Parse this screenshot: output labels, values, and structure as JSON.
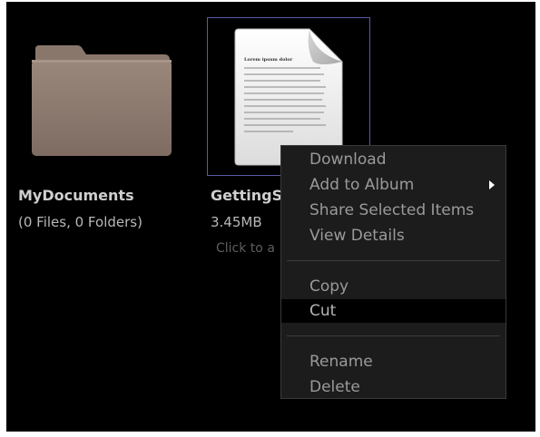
{
  "folder": {
    "name": "MyDocuments",
    "meta": "(0 Files, 0 Folders)",
    "icon": "folder-icon",
    "color": "#8c7a70"
  },
  "file": {
    "name": "GettingS",
    "size": "3.45MB",
    "hint": "Click to a",
    "icon": "document-icon",
    "doc_heading": "Lorem ipsum dolor"
  },
  "context_menu": {
    "items": [
      {
        "label": "Download"
      },
      {
        "label": "Add to Album",
        "submenu": true
      },
      {
        "label": "Share Selected Items"
      },
      {
        "label": "View Details"
      },
      {
        "label": "Copy"
      },
      {
        "label": "Cut",
        "highlighted": true
      },
      {
        "label": "Rename"
      },
      {
        "label": "Delete"
      }
    ]
  },
  "colors": {
    "background": "#000000",
    "menu_background": "#1c1c1c",
    "selection_border": "#5a5aa8"
  }
}
